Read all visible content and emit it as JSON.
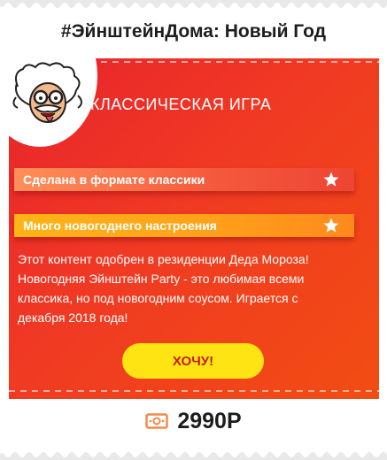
{
  "product": {
    "title": "#ЭйнштейнДома: Новый Год",
    "heading": "КЛАССИЧЕСКАЯ ИГРА",
    "features": [
      "Сделана в формате классики",
      "Много новогоднего настроения"
    ],
    "description": "Этот контент одобрен в резиденции Деда Мороза! Новогодняя Эйнштейн Party - это любимая всеми классика, но под новогодним соусом. Играется с декабря 2018 года!",
    "cta_label": "ХОЧУ!",
    "price": "2990Р"
  },
  "colors": {
    "promo_red": "#e8232c",
    "promo_orange": "#f24d12",
    "ribbon_coral": "#f4583c",
    "ribbon_amber": "#ffa21a",
    "button_yellow": "#ffe414",
    "button_text": "#c41b1b",
    "price_icon": "#f08a4b",
    "text_dark": "#1d1d1d"
  },
  "icons": {
    "mascot": "einstein-mascot-icon",
    "star": "star-icon",
    "price": "banknote-icon"
  }
}
